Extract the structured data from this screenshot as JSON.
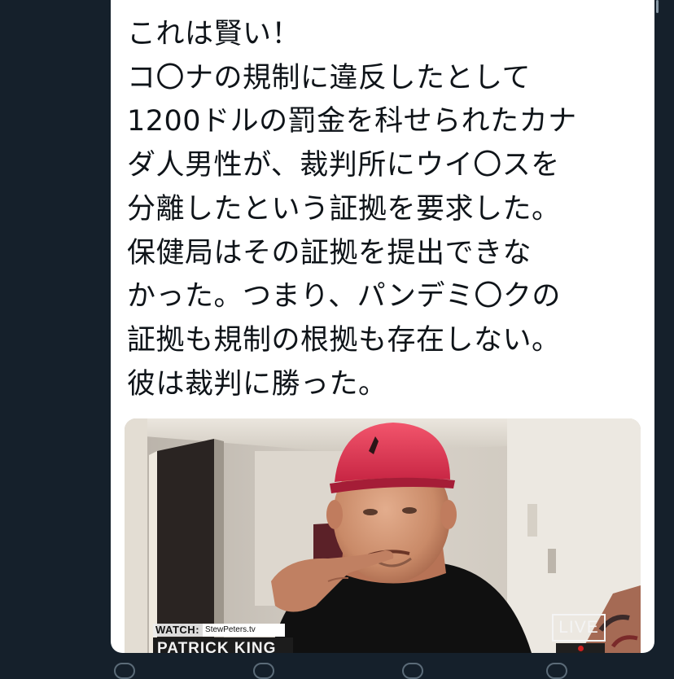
{
  "tweet": {
    "text_lines": [
      "これは賢い！",
      "コ〇ナの規制に違反したとして",
      "1200ドルの罰金を科せられたカナ",
      "ダ人男性が、裁判所にウイ〇スを",
      "分離したという証拠を要求した。",
      "保健局はその証拠を提出できな",
      "かった。つまり、パンデミ〇クの",
      "証拠も規制の根拠も存在しない。",
      "彼は裁判に勝った。"
    ]
  },
  "video": {
    "watch_label": "WATCH:",
    "watch_site": "StewPeters.tv",
    "lower_third_name": "PATRICK KING",
    "live_label": "LIVE"
  },
  "colors": {
    "page_background": "#15202b",
    "card_background": "#ffffff",
    "text": "#0f1419",
    "cap_red": "#e0304e",
    "live_dot": "#d01f1f"
  },
  "icons": {
    "action_bar": [
      "reply-icon",
      "retweet-icon",
      "like-icon",
      "share-icon"
    ]
  }
}
